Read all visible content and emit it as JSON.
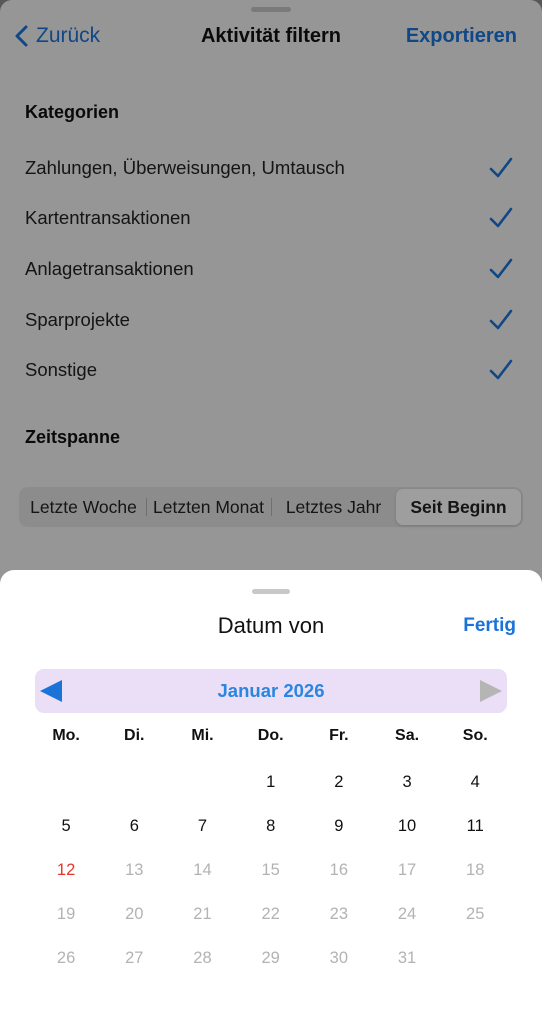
{
  "nav": {
    "back_label": "Zurück",
    "title": "Aktivität filtern",
    "export_label": "Exportieren"
  },
  "categories": {
    "heading": "Kategorien",
    "items": [
      {
        "label": "Zahlungen, Überweisungen, Umtausch",
        "checked": true
      },
      {
        "label": "Kartentransaktionen",
        "checked": true
      },
      {
        "label": "Anlagetransaktionen",
        "checked": true
      },
      {
        "label": "Sparprojekte",
        "checked": true
      },
      {
        "label": "Sonstige",
        "checked": true
      }
    ]
  },
  "timespan": {
    "heading": "Zeitspanne",
    "segments": [
      {
        "label": "Letzte Woche",
        "active": false
      },
      {
        "label": "Letzten Monat",
        "active": false
      },
      {
        "label": "Letztes Jahr",
        "active": false
      },
      {
        "label": "Seit Beginn",
        "active": true
      }
    ]
  },
  "sheet": {
    "title": "Datum von",
    "done_label": "Fertig",
    "month_label": "Januar 2026",
    "prev_icon": "triangle-left-icon",
    "next_icon": "triangle-right-icon",
    "weekdays": [
      "Mo.",
      "Di.",
      "Mi.",
      "Do.",
      "Fr.",
      "Sa.",
      "So."
    ],
    "weeks": [
      [
        {
          "day": "",
          "state": "empty"
        },
        {
          "day": "",
          "state": "empty"
        },
        {
          "day": "",
          "state": "empty"
        },
        {
          "day": "1",
          "state": "normal"
        },
        {
          "day": "2",
          "state": "normal"
        },
        {
          "day": "3",
          "state": "normal"
        },
        {
          "day": "4",
          "state": "normal"
        }
      ],
      [
        {
          "day": "5",
          "state": "normal"
        },
        {
          "day": "6",
          "state": "normal"
        },
        {
          "day": "7",
          "state": "normal"
        },
        {
          "day": "8",
          "state": "normal"
        },
        {
          "day": "9",
          "state": "normal"
        },
        {
          "day": "10",
          "state": "normal"
        },
        {
          "day": "11",
          "state": "normal"
        }
      ],
      [
        {
          "day": "12",
          "state": "today"
        },
        {
          "day": "13",
          "state": "disabled"
        },
        {
          "day": "14",
          "state": "disabled"
        },
        {
          "day": "15",
          "state": "disabled"
        },
        {
          "day": "16",
          "state": "disabled"
        },
        {
          "day": "17",
          "state": "disabled"
        },
        {
          "day": "18",
          "state": "disabled"
        }
      ],
      [
        {
          "day": "19",
          "state": "disabled"
        },
        {
          "day": "20",
          "state": "disabled"
        },
        {
          "day": "21",
          "state": "disabled"
        },
        {
          "day": "22",
          "state": "disabled"
        },
        {
          "day": "23",
          "state": "disabled"
        },
        {
          "day": "24",
          "state": "disabled"
        },
        {
          "day": "25",
          "state": "disabled"
        }
      ],
      [
        {
          "day": "26",
          "state": "disabled"
        },
        {
          "day": "27",
          "state": "disabled"
        },
        {
          "day": "28",
          "state": "disabled"
        },
        {
          "day": "29",
          "state": "disabled"
        },
        {
          "day": "30",
          "state": "disabled"
        },
        {
          "day": "31",
          "state": "disabled"
        },
        {
          "day": "",
          "state": "empty"
        }
      ]
    ]
  },
  "colors": {
    "accent": "#1a73d9",
    "today": "#e8352b",
    "month_bar": "#eadff6",
    "disabled": "#b3b3b3"
  }
}
